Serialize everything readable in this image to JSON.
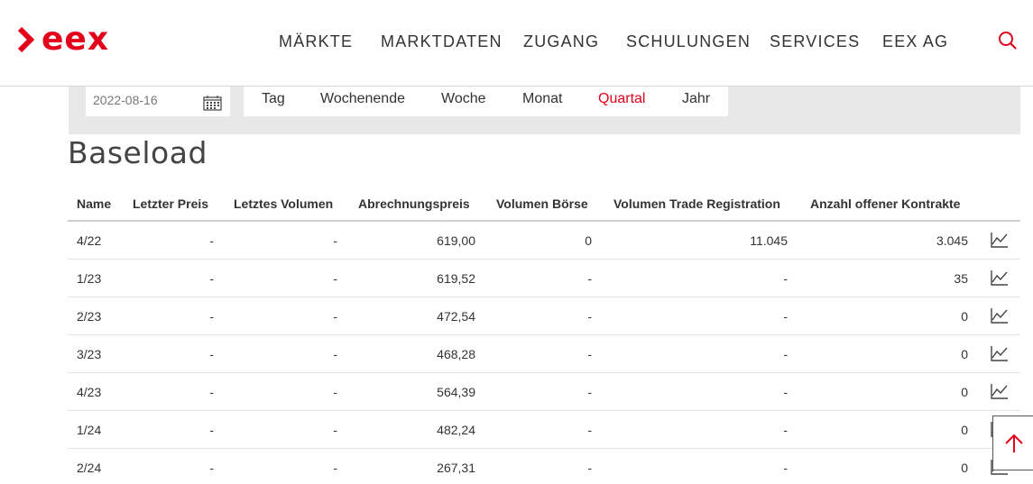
{
  "brand": {
    "name": "eex",
    "color": "#e2001a"
  },
  "nav": {
    "items": [
      "MÄRKTE",
      "MARKTDATEN",
      "ZUGANG",
      "SCHULUNGEN",
      "SERVICES",
      "EEX AG"
    ],
    "search_icon": "search-icon"
  },
  "filter": {
    "date": "2022-08-16",
    "calendar_icon": "calendar-icon",
    "tabs": [
      "Tag",
      "Wochenende",
      "Woche",
      "Monat",
      "Quartal",
      "Jahr"
    ],
    "active_tab": "Quartal"
  },
  "section": {
    "title": "Baseload"
  },
  "table": {
    "columns": [
      "Name",
      "Letzter Preis",
      "Letztes Volumen",
      "Abrechnungspreis",
      "Volumen Börse",
      "Volumen Trade Registration",
      "Anzahl offener Kontrakte"
    ],
    "rows": [
      [
        "4/22",
        "-",
        "-",
        "619,00",
        "0",
        "11.045",
        "3.045"
      ],
      [
        "1/23",
        "-",
        "-",
        "619,52",
        "-",
        "-",
        "35"
      ],
      [
        "2/23",
        "-",
        "-",
        "472,54",
        "-",
        "-",
        "0"
      ],
      [
        "3/23",
        "-",
        "-",
        "468,28",
        "-",
        "-",
        "0"
      ],
      [
        "4/23",
        "-",
        "-",
        "564,39",
        "-",
        "-",
        "0"
      ],
      [
        "1/24",
        "-",
        "-",
        "482,24",
        "-",
        "-",
        "0"
      ],
      [
        "2/24",
        "-",
        "-",
        "267,31",
        "-",
        "-",
        "0"
      ]
    ],
    "row_icon": "line-chart-icon"
  },
  "back_to_top_icon": "arrow-up-icon",
  "colors": {
    "accent": "#e2001a",
    "filter_bg": "#e8e8e8",
    "text": "#333333"
  }
}
